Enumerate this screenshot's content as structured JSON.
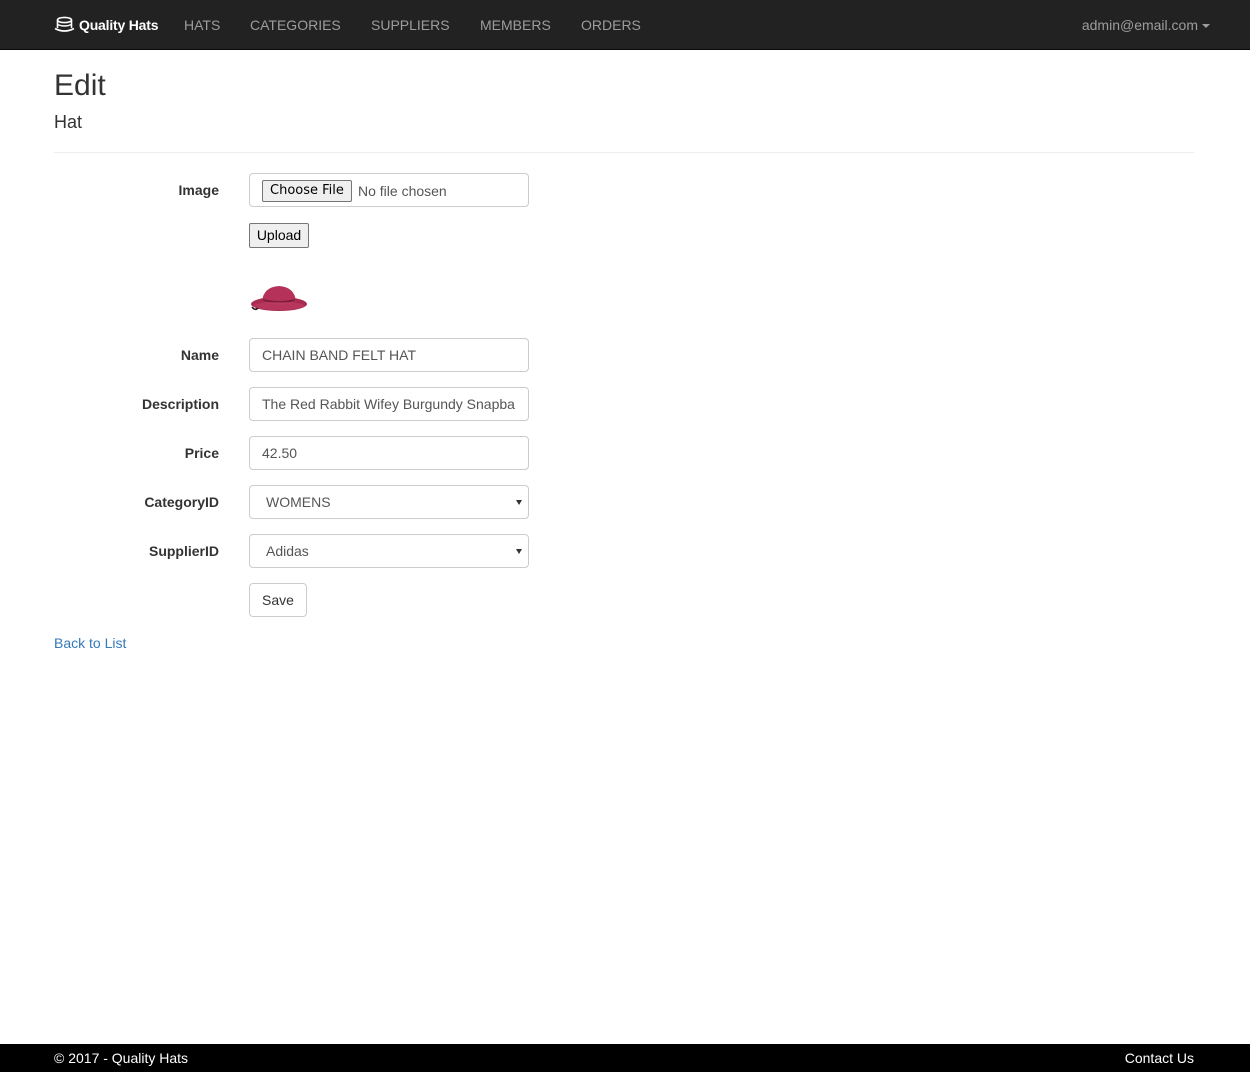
{
  "navbar": {
    "brand": "Quality Hats",
    "brand_icon": "top-hat-icon",
    "links": [
      "HATS",
      "CATEGORIES",
      "SUPPLIERS",
      "MEMBERS",
      "ORDERS"
    ],
    "user": "admin@email.com"
  },
  "page": {
    "title": "Edit",
    "subtitle": "Hat"
  },
  "form": {
    "image": {
      "label": "Image",
      "choose_button": "Choose File",
      "file_status": "No file chosen",
      "upload_button": "Upload",
      "preview_icon": "hat-image"
    },
    "name": {
      "label": "Name",
      "value": "CHAIN BAND FELT HAT"
    },
    "description": {
      "label": "Description",
      "value": "The Red Rabbit Wifey Burgundy Snapba"
    },
    "price": {
      "label": "Price",
      "value": "42.50"
    },
    "category": {
      "label": "CategoryID",
      "selected": "WOMENS"
    },
    "supplier": {
      "label": "SupplierID",
      "selected": "Adidas"
    },
    "save_button": "Save"
  },
  "back_link": "Back to List",
  "footer": {
    "copyright": "© 2017 - Quality Hats",
    "contact": "Contact Us"
  },
  "colors": {
    "navbar_bg": "#222222",
    "nav_text": "#9d9d9d",
    "link": "#337ab7",
    "hat": "#b5325a",
    "footer_bg": "#000000"
  }
}
